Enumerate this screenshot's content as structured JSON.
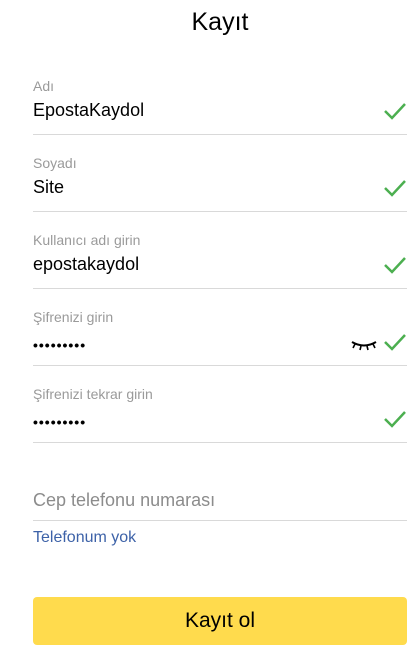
{
  "page": {
    "title": "Kayıt"
  },
  "form": {
    "first_name": {
      "label": "Adı",
      "value": "EpostaKaydol",
      "valid": true
    },
    "last_name": {
      "label": "Soyadı",
      "value": "Site",
      "valid": true
    },
    "username": {
      "label": "Kullanıcı adı girin",
      "value": "epostakaydol",
      "valid": true
    },
    "password": {
      "label": "Şifrenizi girin",
      "value": "•••••••••",
      "valid": true
    },
    "password_repeat": {
      "label": "Şifrenizi tekrar girin",
      "value": "•••••••••",
      "valid": true
    },
    "phone": {
      "placeholder": "Cep telefonu numarası",
      "no_phone_link": "Telefonum yok"
    },
    "submit_label": "Kayıt ol"
  },
  "colors": {
    "check": "#4caf50",
    "button": "#ffdb4d",
    "link": "#3d62a8"
  },
  "icons": [
    "check-icon",
    "eye-closed-icon"
  ]
}
